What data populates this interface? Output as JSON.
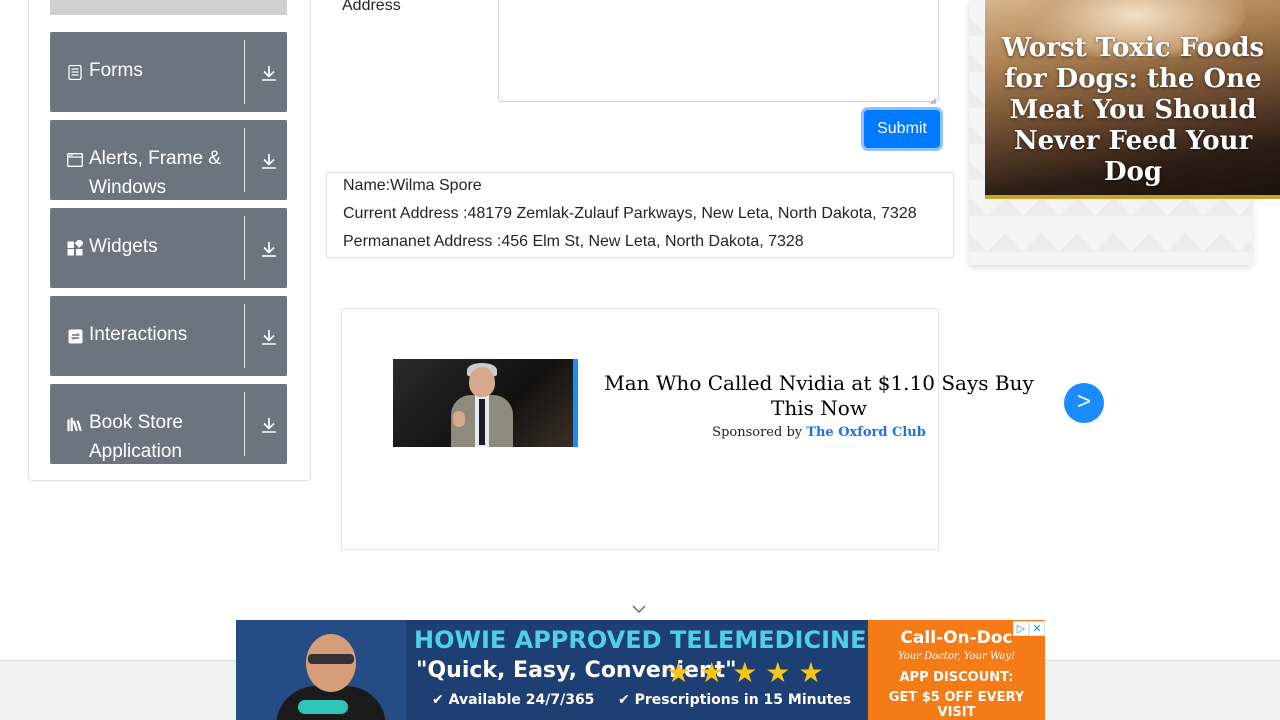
{
  "sidebar": {
    "groups": [
      {
        "title": "Forms",
        "icon": "form-document-icon"
      },
      {
        "title": "Alerts, Frame & Windows",
        "icon": "window-icon"
      },
      {
        "title": "Widgets",
        "icon": "widgets-icon"
      },
      {
        "title": "Interactions",
        "icon": "interactions-icon"
      },
      {
        "title": "Book Store Application",
        "icon": "books-icon"
      }
    ]
  },
  "form": {
    "address_label": "Address",
    "submit_label": "Submit"
  },
  "output": {
    "name": "Name:Wilma Spore",
    "current_address": "Current Address :48179 Zemlak-Zulauf Parkways, New Leta, North Dakota, 7328",
    "permanent_address": "Permananet Address :456 Elm St, New Leta, North Dakota, 7328"
  },
  "ad_center": {
    "headline": "Man Who Called Nvidia at $1.10 Says Buy This Now",
    "sponsored_prefix": "Sponsored by",
    "sponsor": "The Oxford Club",
    "arrow": ">"
  },
  "ad_right": {
    "title": "Worst Toxic Foods for Dogs: the One Meat You Should Never Feed Your Dog"
  },
  "banner": {
    "headline": "HOWIE APPROVED TELEMEDICINE",
    "quote": "\"Quick, Easy, Convenient\"",
    "stars": "★★★★★",
    "feature1": "✔ Available 24/7/365",
    "feature2": "✔ Prescriptions in 15 Minutes",
    "cta_brand": "Call-On-Doc",
    "cta_tagline": "Your Doctor, Your Way!",
    "cta_line1": "APP DISCOUNT:",
    "cta_line2": "GET $5 OFF EVERY VISIT",
    "adchoice": "▷",
    "close": "✕"
  },
  "colors": {
    "sidebar_group": "#6c757d",
    "submit": "#007bff",
    "ad_link": "#1a73e8",
    "banner_bg": "#1e3f74",
    "banner_cta": "#f47b16"
  }
}
